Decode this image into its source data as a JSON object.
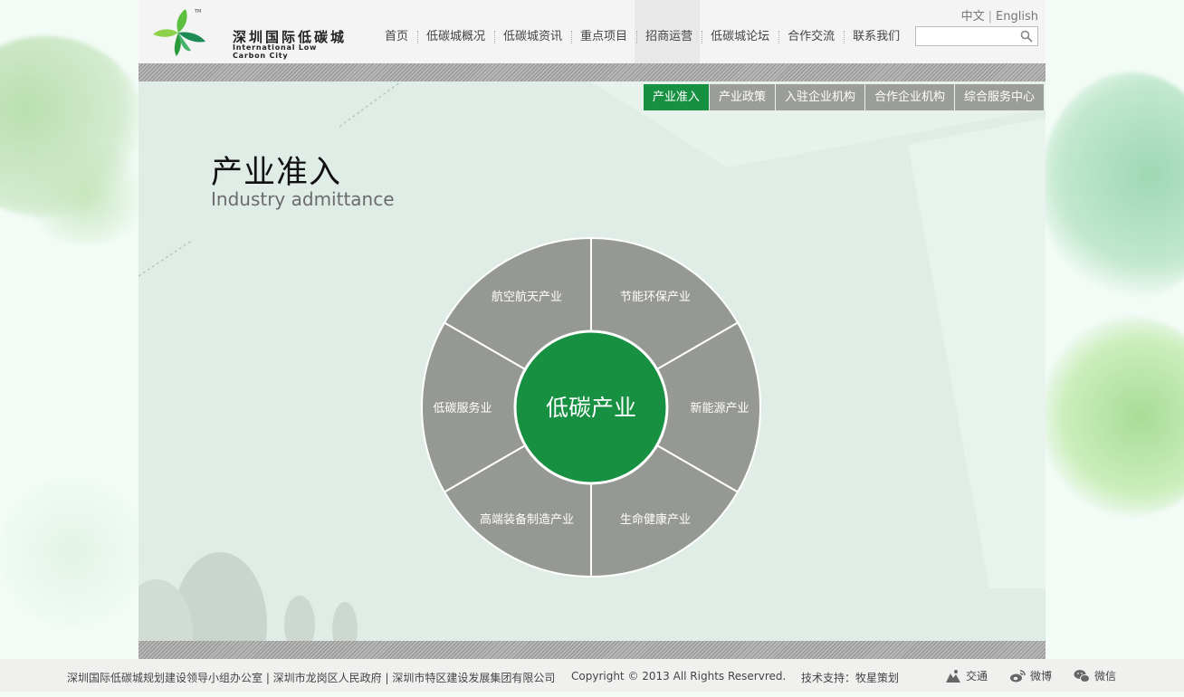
{
  "header": {
    "logo_cn": "深圳国际低碳城",
    "logo_en": "International Low Carbon City",
    "lang_cn": "中文",
    "lang_en": "English",
    "nav": [
      {
        "label": "首页"
      },
      {
        "label": "低碳城概况"
      },
      {
        "label": "低碳城资讯"
      },
      {
        "label": "重点项目"
      },
      {
        "label": "招商运营"
      },
      {
        "label": "低碳城论坛"
      },
      {
        "label": "合作交流"
      },
      {
        "label": "联系我们"
      }
    ],
    "active_nav": "招商运营",
    "search": {
      "value": "",
      "placeholder": ""
    }
  },
  "subnav": [
    {
      "label": "产业准入"
    },
    {
      "label": "产业政策"
    },
    {
      "label": "入驻企业机构"
    },
    {
      "label": "合作企业机构"
    },
    {
      "label": "综合服务中心"
    }
  ],
  "active_subnav": "产业准入",
  "page": {
    "title": "产业准入",
    "subtitle": "Industry admittance"
  },
  "wheel": {
    "center": "低碳产业",
    "segments": [
      {
        "label": "节能环保产业"
      },
      {
        "label": "新能源产业"
      },
      {
        "label": "生命健康产业"
      },
      {
        "label": "高端装备制造产业"
      },
      {
        "label": "低碳服务业"
      },
      {
        "label": "航空航天产业"
      }
    ],
    "colors": {
      "segment": "#959893",
      "center": "#179042",
      "border": "#ffffff"
    }
  },
  "footer": {
    "links": "深圳国际低碳城规划建设领导小组办公室 | 深圳市龙岗区人民政府 | 深圳市特区建设发展集团有限公司",
    "copyright": "Copyright © 2013 All Rights Reservred.",
    "tech": "技术支持：牧星策划",
    "social": [
      {
        "label": "交通",
        "icon": "map-icon"
      },
      {
        "label": "微博",
        "icon": "weibo-icon"
      },
      {
        "label": "微信",
        "icon": "wechat-icon"
      }
    ]
  },
  "colors": {
    "brand_green": "#179042",
    "nav_text": "#444444",
    "subtab_bg": "#9a9d98"
  }
}
